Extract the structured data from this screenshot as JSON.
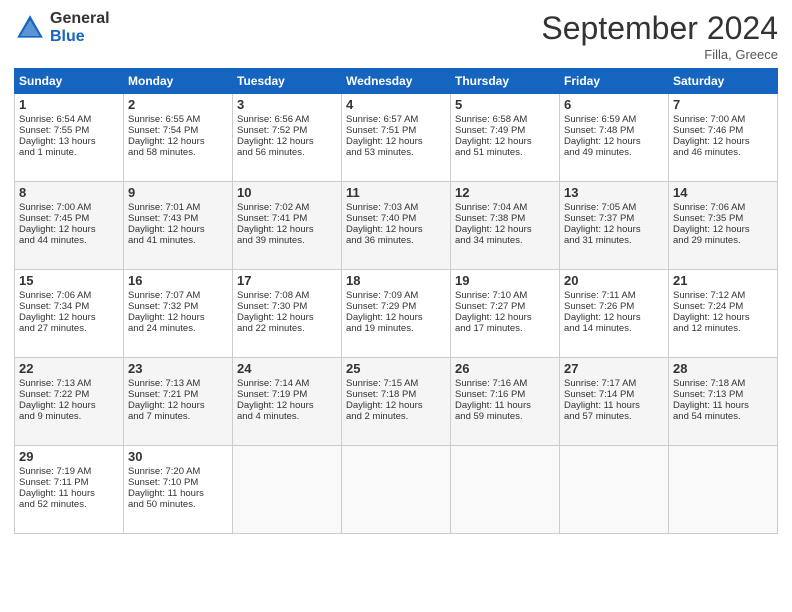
{
  "header": {
    "logo_line1": "General",
    "logo_line2": "Blue",
    "month": "September 2024",
    "location": "Filla, Greece"
  },
  "weekdays": [
    "Sunday",
    "Monday",
    "Tuesday",
    "Wednesday",
    "Thursday",
    "Friday",
    "Saturday"
  ],
  "weeks": [
    [
      {
        "day": "1",
        "info": "Sunrise: 6:54 AM\nSunset: 7:55 PM\nDaylight: 13 hours\nand 1 minute."
      },
      {
        "day": "2",
        "info": "Sunrise: 6:55 AM\nSunset: 7:54 PM\nDaylight: 12 hours\nand 58 minutes."
      },
      {
        "day": "3",
        "info": "Sunrise: 6:56 AM\nSunset: 7:52 PM\nDaylight: 12 hours\nand 56 minutes."
      },
      {
        "day": "4",
        "info": "Sunrise: 6:57 AM\nSunset: 7:51 PM\nDaylight: 12 hours\nand 53 minutes."
      },
      {
        "day": "5",
        "info": "Sunrise: 6:58 AM\nSunset: 7:49 PM\nDaylight: 12 hours\nand 51 minutes."
      },
      {
        "day": "6",
        "info": "Sunrise: 6:59 AM\nSunset: 7:48 PM\nDaylight: 12 hours\nand 49 minutes."
      },
      {
        "day": "7",
        "info": "Sunrise: 7:00 AM\nSunset: 7:46 PM\nDaylight: 12 hours\nand 46 minutes."
      }
    ],
    [
      {
        "day": "8",
        "info": "Sunrise: 7:00 AM\nSunset: 7:45 PM\nDaylight: 12 hours\nand 44 minutes."
      },
      {
        "day": "9",
        "info": "Sunrise: 7:01 AM\nSunset: 7:43 PM\nDaylight: 12 hours\nand 41 minutes."
      },
      {
        "day": "10",
        "info": "Sunrise: 7:02 AM\nSunset: 7:41 PM\nDaylight: 12 hours\nand 39 minutes."
      },
      {
        "day": "11",
        "info": "Sunrise: 7:03 AM\nSunset: 7:40 PM\nDaylight: 12 hours\nand 36 minutes."
      },
      {
        "day": "12",
        "info": "Sunrise: 7:04 AM\nSunset: 7:38 PM\nDaylight: 12 hours\nand 34 minutes."
      },
      {
        "day": "13",
        "info": "Sunrise: 7:05 AM\nSunset: 7:37 PM\nDaylight: 12 hours\nand 31 minutes."
      },
      {
        "day": "14",
        "info": "Sunrise: 7:06 AM\nSunset: 7:35 PM\nDaylight: 12 hours\nand 29 minutes."
      }
    ],
    [
      {
        "day": "15",
        "info": "Sunrise: 7:06 AM\nSunset: 7:34 PM\nDaylight: 12 hours\nand 27 minutes."
      },
      {
        "day": "16",
        "info": "Sunrise: 7:07 AM\nSunset: 7:32 PM\nDaylight: 12 hours\nand 24 minutes."
      },
      {
        "day": "17",
        "info": "Sunrise: 7:08 AM\nSunset: 7:30 PM\nDaylight: 12 hours\nand 22 minutes."
      },
      {
        "day": "18",
        "info": "Sunrise: 7:09 AM\nSunset: 7:29 PM\nDaylight: 12 hours\nand 19 minutes."
      },
      {
        "day": "19",
        "info": "Sunrise: 7:10 AM\nSunset: 7:27 PM\nDaylight: 12 hours\nand 17 minutes."
      },
      {
        "day": "20",
        "info": "Sunrise: 7:11 AM\nSunset: 7:26 PM\nDaylight: 12 hours\nand 14 minutes."
      },
      {
        "day": "21",
        "info": "Sunrise: 7:12 AM\nSunset: 7:24 PM\nDaylight: 12 hours\nand 12 minutes."
      }
    ],
    [
      {
        "day": "22",
        "info": "Sunrise: 7:13 AM\nSunset: 7:22 PM\nDaylight: 12 hours\nand 9 minutes."
      },
      {
        "day": "23",
        "info": "Sunrise: 7:13 AM\nSunset: 7:21 PM\nDaylight: 12 hours\nand 7 minutes."
      },
      {
        "day": "24",
        "info": "Sunrise: 7:14 AM\nSunset: 7:19 PM\nDaylight: 12 hours\nand 4 minutes."
      },
      {
        "day": "25",
        "info": "Sunrise: 7:15 AM\nSunset: 7:18 PM\nDaylight: 12 hours\nand 2 minutes."
      },
      {
        "day": "26",
        "info": "Sunrise: 7:16 AM\nSunset: 7:16 PM\nDaylight: 11 hours\nand 59 minutes."
      },
      {
        "day": "27",
        "info": "Sunrise: 7:17 AM\nSunset: 7:14 PM\nDaylight: 11 hours\nand 57 minutes."
      },
      {
        "day": "28",
        "info": "Sunrise: 7:18 AM\nSunset: 7:13 PM\nDaylight: 11 hours\nand 54 minutes."
      }
    ],
    [
      {
        "day": "29",
        "info": "Sunrise: 7:19 AM\nSunset: 7:11 PM\nDaylight: 11 hours\nand 52 minutes."
      },
      {
        "day": "30",
        "info": "Sunrise: 7:20 AM\nSunset: 7:10 PM\nDaylight: 11 hours\nand 50 minutes."
      },
      {
        "day": "",
        "info": ""
      },
      {
        "day": "",
        "info": ""
      },
      {
        "day": "",
        "info": ""
      },
      {
        "day": "",
        "info": ""
      },
      {
        "day": "",
        "info": ""
      }
    ]
  ]
}
